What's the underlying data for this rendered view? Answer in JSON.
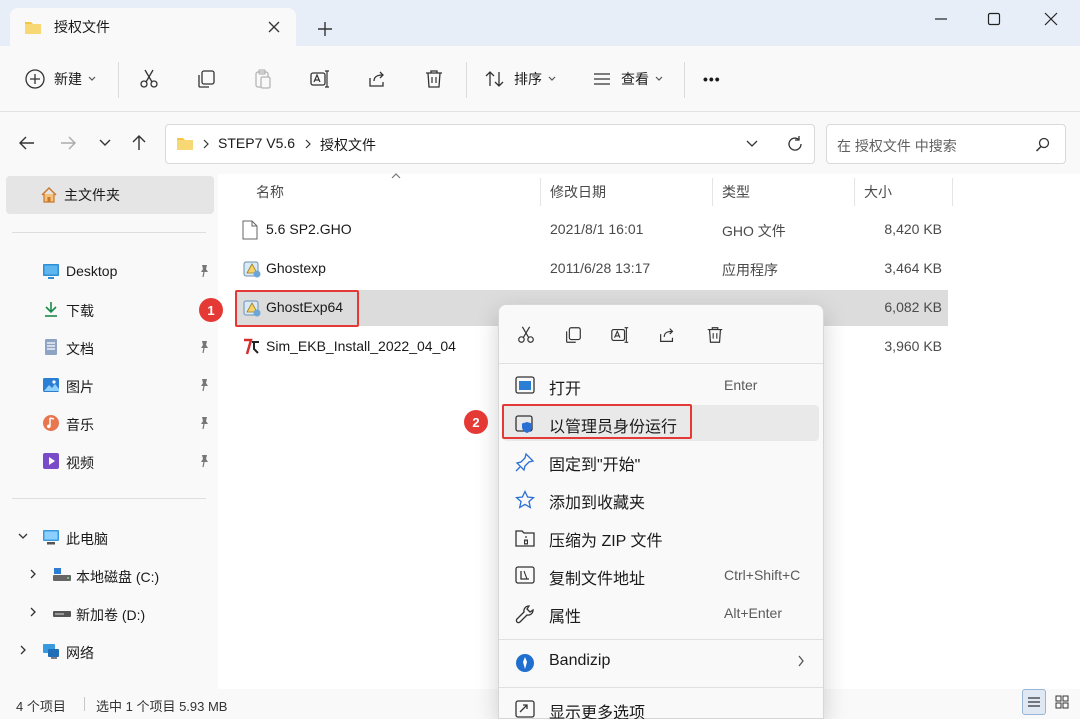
{
  "window": {
    "tab_title": "授权文件",
    "controls": [
      "minimize-icon",
      "maximize-icon",
      "close-icon"
    ]
  },
  "toolbar": {
    "new_label": "新建",
    "sort_label": "排序",
    "view_label": "查看",
    "more_label": "•••",
    "icons": [
      "cut-icon",
      "copy-icon",
      "paste-icon",
      "rename-icon",
      "share-icon",
      "delete-icon"
    ]
  },
  "address": {
    "crumbs": [
      "STEP7 V5.6",
      "授权文件"
    ],
    "search_placeholder": "在 授权文件 中搜索"
  },
  "sidebar": {
    "home": "主文件夹",
    "quick": [
      {
        "label": "Desktop",
        "icon": "desktop-icon",
        "pinned": true
      },
      {
        "label": "下载",
        "icon": "download-icon",
        "pinned": true
      },
      {
        "label": "文档",
        "icon": "documents-icon",
        "pinned": true
      },
      {
        "label": "图片",
        "icon": "pictures-icon",
        "pinned": true
      },
      {
        "label": "音乐",
        "icon": "music-icon",
        "pinned": true
      },
      {
        "label": "视频",
        "icon": "videos-icon",
        "pinned": true
      }
    ],
    "this_pc": "此电脑",
    "drives": [
      {
        "label": "本地磁盘 (C:)",
        "icon": "drive-c-icon"
      },
      {
        "label": "新加卷 (D:)",
        "icon": "drive-d-icon"
      }
    ],
    "network": "网络"
  },
  "columns": {
    "name": "名称",
    "date": "修改日期",
    "type": "类型",
    "size": "大小"
  },
  "files": [
    {
      "name": "5.6 SP2.GHO",
      "date": "2021/8/1 16:01",
      "type": "GHO 文件",
      "size": "8,420 KB",
      "icon": "file-icon"
    },
    {
      "name": "Ghostexp",
      "date": "2011/6/28 13:17",
      "type": "应用程序",
      "size": "3,464 KB",
      "icon": "ghost-app-icon"
    },
    {
      "name": "GhostExp64",
      "date": "",
      "type": "",
      "size": "6,082 KB",
      "icon": "ghost-app-icon",
      "selected": true
    },
    {
      "name": "Sim_EKB_Install_2022_04_04",
      "date": "",
      "type": "",
      "size": "3,960 KB",
      "icon": "ekb-app-icon"
    }
  ],
  "status": {
    "count": "4 个项目",
    "selection": "选中 1 个项目 5.93 MB"
  },
  "annotations": {
    "badge1": "1",
    "badge2": "2"
  },
  "context_menu": {
    "quick_icons": [
      "cut-icon",
      "copy-icon",
      "rename-icon",
      "share-icon",
      "delete-icon"
    ],
    "items": [
      {
        "label": "打开",
        "shortcut": "Enter",
        "icon": "open-icon"
      },
      {
        "label": "以管理员身份运行",
        "shortcut": "",
        "icon": "shield-icon"
      },
      {
        "label": "固定到\"开始\"",
        "shortcut": "",
        "icon": "pin-icon"
      },
      {
        "label": "添加到收藏夹",
        "shortcut": "",
        "icon": "star-icon"
      },
      {
        "label": "压缩为 ZIP 文件",
        "shortcut": "",
        "icon": "zip-icon"
      },
      {
        "label": "复制文件地址",
        "shortcut": "Ctrl+Shift+C",
        "icon": "copy-path-icon"
      },
      {
        "label": "属性",
        "shortcut": "Alt+Enter",
        "icon": "wrench-icon"
      },
      {
        "label": "Bandizip",
        "shortcut": "",
        "icon": "bandizip-icon"
      },
      {
        "label": "显示更多选项",
        "shortcut": "",
        "icon": "more-options-icon"
      }
    ]
  },
  "colors": {
    "accent": "#0067c0",
    "marker": "#e53935",
    "folder": "#f3c64b"
  }
}
